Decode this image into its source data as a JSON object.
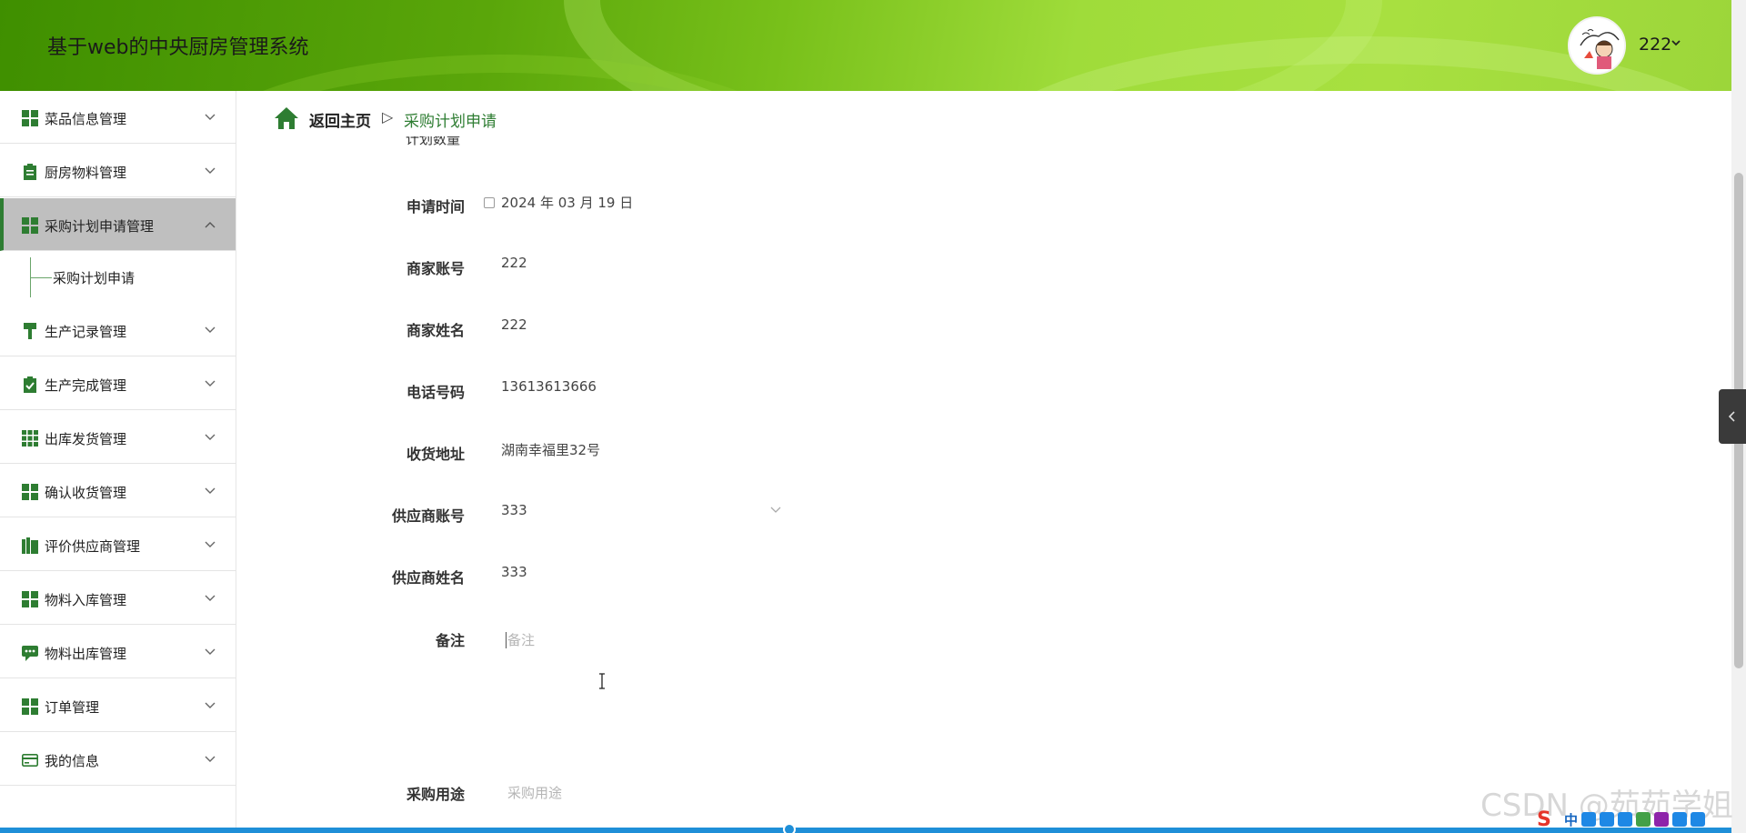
{
  "app": {
    "title": "基于web的中央厨房管理系统",
    "username": "222"
  },
  "colors": {
    "brand_green": "#2e7d32",
    "header_start": "#3f8f00",
    "header_end": "#a8e040",
    "active_menu_bg": "#bfbfbf"
  },
  "sidebar": {
    "items": [
      {
        "label": "菜品信息管理",
        "icon": "grid-icon"
      },
      {
        "label": "厨房物料管理",
        "icon": "clipboard-icon"
      },
      {
        "label": "采购计划申请管理",
        "icon": "grid-icon",
        "expanded": true
      },
      {
        "label": "生产记录管理",
        "icon": "paint-roller-icon"
      },
      {
        "label": "生产完成管理",
        "icon": "clipboard-check-icon"
      },
      {
        "label": "出库发货管理",
        "icon": "grid-nine-icon"
      },
      {
        "label": "确认收货管理",
        "icon": "grid-icon"
      },
      {
        "label": "评价供应商管理",
        "icon": "bar-book-icon"
      },
      {
        "label": "物料入库管理",
        "icon": "grid-icon"
      },
      {
        "label": "物料出库管理",
        "icon": "chat-icon"
      },
      {
        "label": "订单管理",
        "icon": "grid-icon"
      },
      {
        "label": "我的信息",
        "icon": "card-icon"
      }
    ],
    "sub_items": [
      {
        "label": "采购计划申请"
      }
    ]
  },
  "breadcrumb": {
    "home": "返回主页",
    "separator": "▷",
    "current": "采购计划申请"
  },
  "form": {
    "partial_label": "计划数量",
    "fields": [
      {
        "label": "申请时间",
        "value": "2024 年 03 月 19 日"
      },
      {
        "label": "商家账号",
        "value": "222"
      },
      {
        "label": "商家姓名",
        "value": "222"
      },
      {
        "label": "电话号码",
        "value": "13613613666"
      },
      {
        "label": "收货地址",
        "value": "湖南幸福里32号"
      },
      {
        "label": "供应商账号",
        "value": "333"
      },
      {
        "label": "供应商姓名",
        "value": "333"
      }
    ],
    "remark_label": "备注",
    "remark_placeholder": "备注",
    "purpose_label": "采购用途",
    "purpose_placeholder": "采购用途"
  },
  "watermark": "CSDN @茹茹学姐",
  "tray": {
    "ime": "S",
    "lang": "中"
  }
}
